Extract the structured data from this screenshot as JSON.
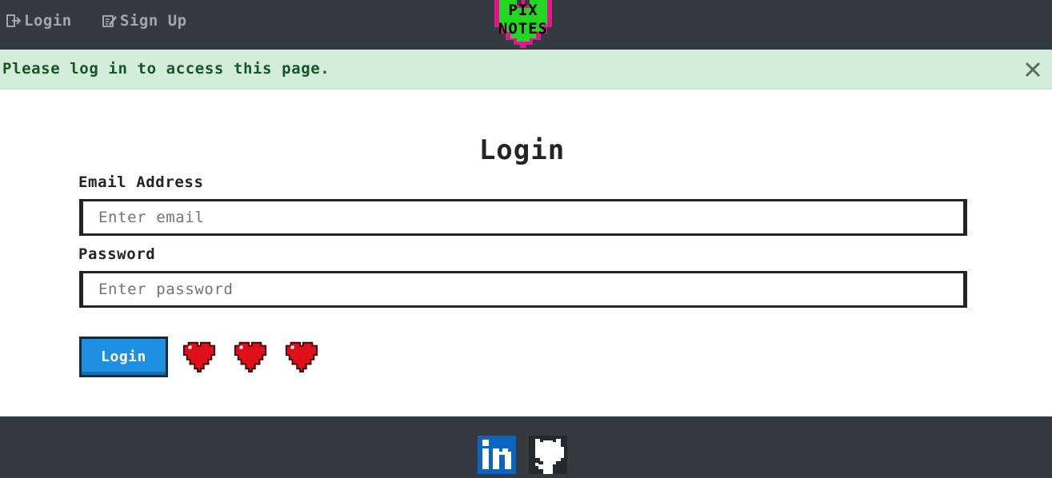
{
  "nav": {
    "login_label": "Login",
    "signup_label": "Sign Up",
    "login_icon": "sign-in-icon",
    "signup_icon": "edit-icon"
  },
  "logo": {
    "line1": "PIX",
    "line2": "NOTES"
  },
  "alert": {
    "message": "Please log in to access this page.",
    "close_icon": "close-icon"
  },
  "form": {
    "title": "Login",
    "email_label": "Email Address",
    "email_placeholder": "Enter email",
    "email_value": "",
    "password_label": "Password",
    "password_placeholder": "Enter password",
    "password_value": "",
    "submit_label": "Login",
    "lives": 3
  },
  "footer": {
    "links": [
      {
        "name": "linkedin-icon"
      },
      {
        "name": "github-icon"
      }
    ]
  },
  "colors": {
    "navbar": "#343a40",
    "alert_bg": "#d4edda",
    "alert_text": "#155724",
    "button": "#1e8fe1",
    "heart": "#e0101a",
    "logo_heart": "#22d822",
    "logo_border": "#e0168f"
  }
}
